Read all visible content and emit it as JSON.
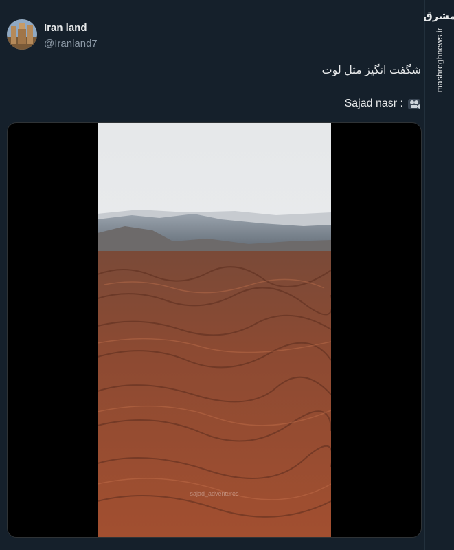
{
  "tweet": {
    "display_name": "Iran land",
    "handle": "@Iranland7",
    "text": "شگفت انگیز مثل لوت",
    "credit_text": "Sajad nasr :",
    "credit_icon": "video-camera-icon"
  },
  "media": {
    "watermark": "sajad_adventures"
  },
  "site": {
    "logo_text": "مشرق",
    "url": "mashreghnews.ir"
  },
  "colors": {
    "background": "#15202b",
    "text": "#e7e9ea",
    "secondary_text": "#8b98a5",
    "media_bg": "#000000"
  }
}
